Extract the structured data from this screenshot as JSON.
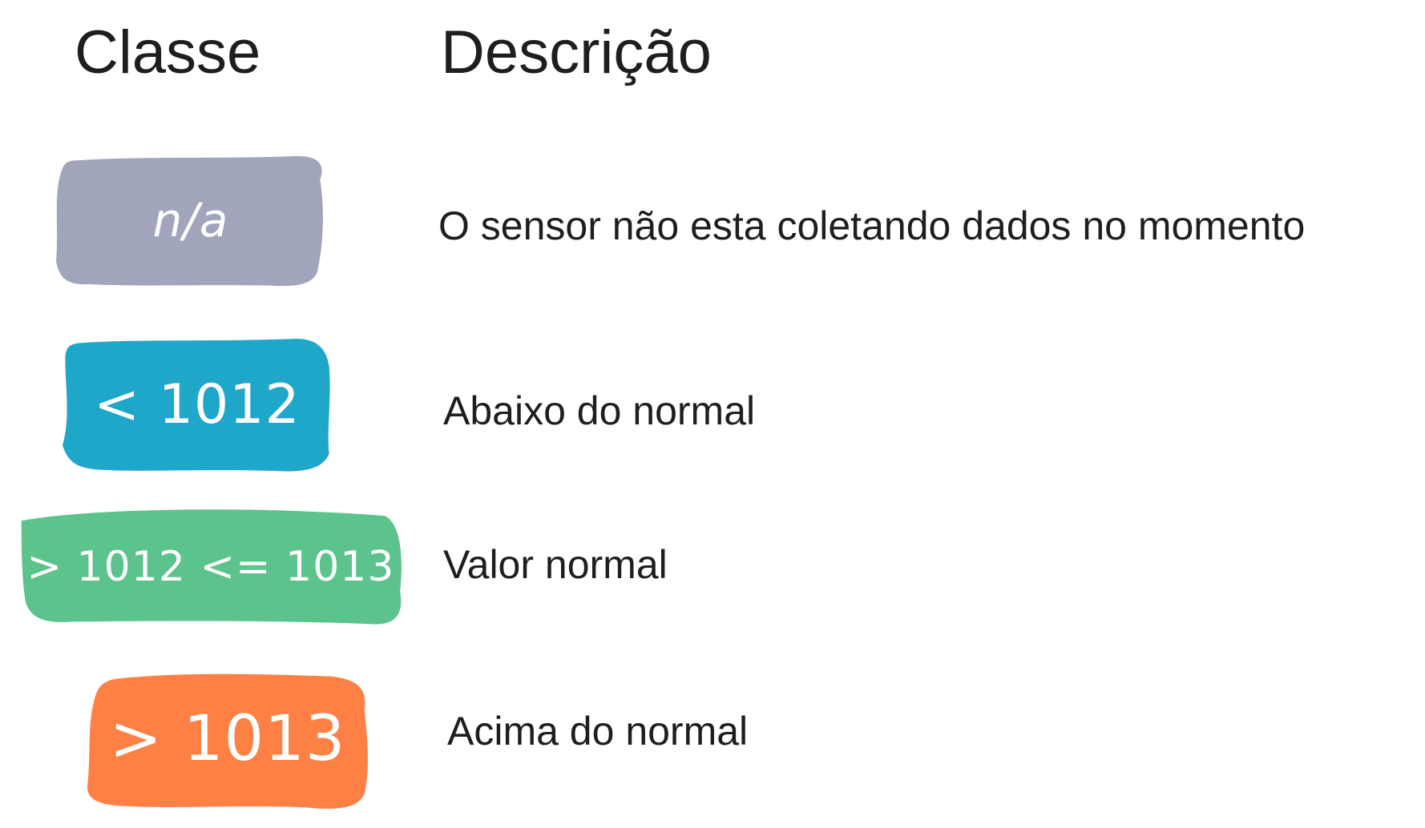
{
  "headers": {
    "class_label": "Classe",
    "description_label": "Descrição"
  },
  "rows": [
    {
      "badge_label": "n/a",
      "badge_color": "#a0a5bb",
      "description": "O sensor não esta coletando dados no momento"
    },
    {
      "badge_label": "< 1012",
      "badge_color": "#1fa7ca",
      "description": "Abaixo do normal"
    },
    {
      "badge_label": "> 1012 <= 1013",
      "badge_color": "#5bc38b",
      "description": "Valor normal"
    },
    {
      "badge_label": "> 1013",
      "badge_color": "#ff8045",
      "description": "Acima do normal"
    }
  ]
}
